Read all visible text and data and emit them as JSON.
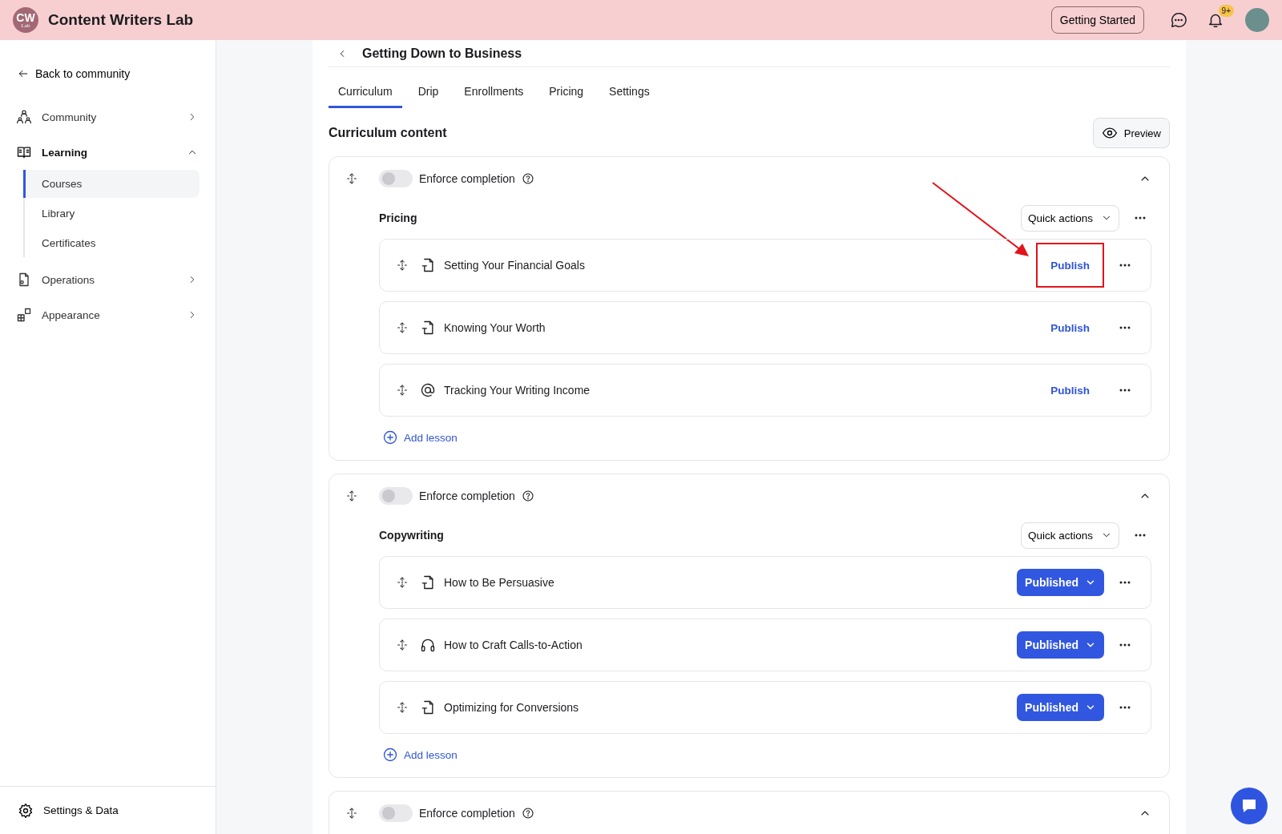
{
  "header": {
    "logo": {
      "initials": "CW",
      "sub": "Lab"
    },
    "title": "Content Writers Lab",
    "getting_started": "Getting Started",
    "notification_badge": "9+"
  },
  "sidebar": {
    "back": "Back to community",
    "items": [
      {
        "label": "Community",
        "expanded": false
      },
      {
        "label": "Learning",
        "expanded": true,
        "children": [
          {
            "label": "Courses",
            "selected": true
          },
          {
            "label": "Library",
            "selected": false
          },
          {
            "label": "Certificates",
            "selected": false
          }
        ]
      },
      {
        "label": "Operations",
        "expanded": false
      },
      {
        "label": "Appearance",
        "expanded": false
      }
    ],
    "footer": "Settings & Data"
  },
  "course": {
    "title": "Getting Down to Business",
    "tabs": [
      {
        "label": "Curriculum",
        "selected": true
      },
      {
        "label": "Drip",
        "selected": false
      },
      {
        "label": "Enrollments",
        "selected": false
      },
      {
        "label": "Pricing",
        "selected": false
      },
      {
        "label": "Settings",
        "selected": false
      }
    ],
    "heading": "Curriculum content",
    "preview": "Preview",
    "sections": [
      {
        "enforce_label": "Enforce completion",
        "enforce_on": false,
        "expanded": true,
        "title": "Pricing",
        "quick_actions": "Quick actions",
        "add_lesson": "Add lesson",
        "lessons": [
          {
            "title": "Setting Your Financial Goals",
            "kind": "document",
            "published": false,
            "action": "Publish",
            "highlighted": true
          },
          {
            "title": "Knowing Your Worth",
            "kind": "document",
            "published": false,
            "action": "Publish",
            "highlighted": false
          },
          {
            "title": "Tracking Your Writing Income",
            "kind": "at",
            "published": false,
            "action": "Publish",
            "highlighted": false
          }
        ]
      },
      {
        "enforce_label": "Enforce completion",
        "enforce_on": false,
        "expanded": true,
        "title": "Copywriting",
        "quick_actions": "Quick actions",
        "add_lesson": "Add lesson",
        "lessons": [
          {
            "title": "How to Be Persuasive",
            "kind": "document",
            "published": true,
            "action": "Published",
            "highlighted": false
          },
          {
            "title": "How to Craft Calls-to-Action",
            "kind": "audio",
            "published": true,
            "action": "Published",
            "highlighted": false
          },
          {
            "title": "Optimizing for Conversions",
            "kind": "document",
            "published": true,
            "action": "Published",
            "highlighted": false
          }
        ]
      },
      {
        "enforce_label": "Enforce completion",
        "enforce_on": false,
        "expanded": true
      }
    ]
  }
}
